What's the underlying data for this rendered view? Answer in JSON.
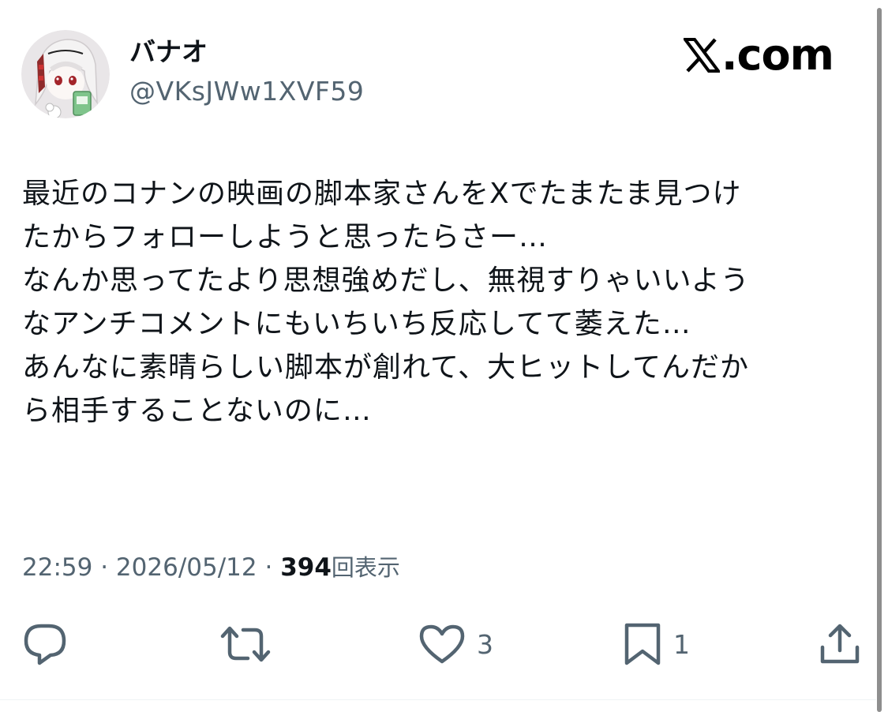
{
  "author": {
    "display_name": "バナオ",
    "handle": "@VKsJWw1XVF59"
  },
  "brand": {
    "label": ".com",
    "logo_icon": "x-logo-icon"
  },
  "tweet": {
    "lines": [
      "最近のコナンの映画の脚本家さんをXでたまたま見つけ",
      "たからフォローしようと思ったらさー…",
      "なんか思ってたより思想強めだし、無視すりゃいいよう",
      "なアンチコメントにもいちいち反応してて萎えた…",
      "あんなに素晴らしい脚本が創れて、大ヒットしてんだか",
      "ら相手することないのに…"
    ]
  },
  "meta": {
    "time": "22:59",
    "separator": "·",
    "date": "2026/05/12",
    "views_count": "394",
    "views_label": "回表示"
  },
  "actions": {
    "reply_icon": "reply-icon",
    "retweet_icon": "retweet-icon",
    "like_icon": "heart-icon",
    "like_count": "3",
    "bookmark_icon": "bookmark-icon",
    "bookmark_count": "1",
    "share_icon": "share-icon"
  },
  "colors": {
    "text_primary": "#0f1419",
    "text_secondary": "#536471",
    "background": "#ffffff"
  }
}
